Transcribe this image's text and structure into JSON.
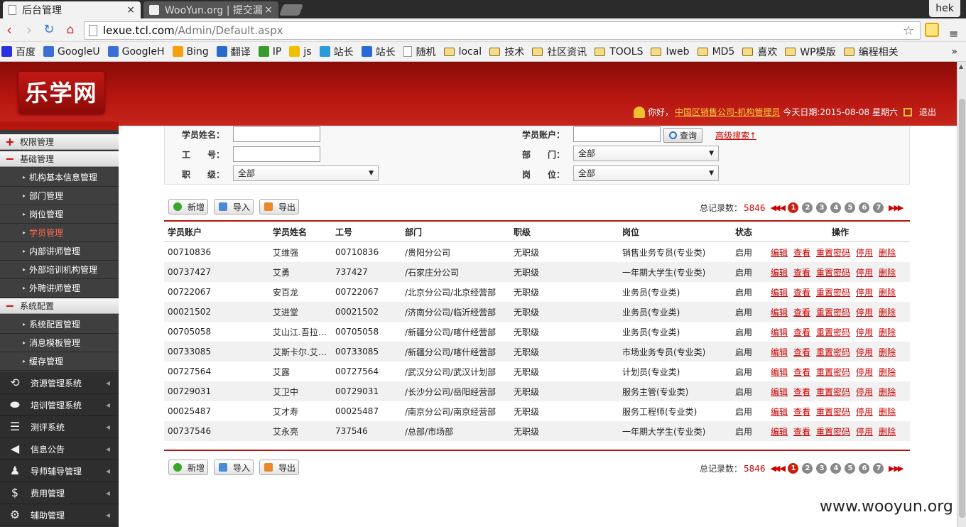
{
  "browser": {
    "tabs": [
      {
        "title": "后台管理",
        "active": true
      },
      {
        "title": "WooYun.org | 提交漏",
        "active": false
      }
    ],
    "user_badge": "hek",
    "url_host": "lexue.tcl.com",
    "url_path": "/Admin/Default.aspx",
    "bookmarks": [
      {
        "label": "百度",
        "icon": "baidu-icon",
        "color": "#2932e1"
      },
      {
        "label": "GoogleU",
        "icon": "google-icon",
        "color": "#3b6fd8"
      },
      {
        "label": "GoogleH",
        "icon": "google-icon",
        "color": "#3b6fd8"
      },
      {
        "label": "Bing",
        "icon": "bing-icon",
        "color": "#f2a10c"
      },
      {
        "label": "翻译",
        "icon": "translate-icon",
        "color": "#2a6ac9"
      },
      {
        "label": "IP",
        "icon": "ip-icon",
        "color": "#3a9a2a"
      },
      {
        "label": "js",
        "icon": "js-icon",
        "color": "#f0c000"
      },
      {
        "label": "站长",
        "icon": "chinaz-icon",
        "color": "#2a9ad8"
      },
      {
        "label": "站长",
        "icon": "chinaz-icon",
        "color": "#2a6ad8"
      },
      {
        "label": "随机",
        "icon": "doc-icon",
        "color": ""
      },
      {
        "label": "local",
        "icon": "folder-icon",
        "color": ""
      },
      {
        "label": "技术",
        "icon": "folder-icon",
        "color": ""
      },
      {
        "label": "社区资讯",
        "icon": "folder-icon",
        "color": ""
      },
      {
        "label": "TOOLS",
        "icon": "folder-icon",
        "color": ""
      },
      {
        "label": "Iweb",
        "icon": "folder-icon",
        "color": ""
      },
      {
        "label": "MD5",
        "icon": "folder-icon",
        "color": ""
      },
      {
        "label": "喜欢",
        "icon": "folder-icon",
        "color": ""
      },
      {
        "label": "WP模版",
        "icon": "folder-icon",
        "color": ""
      },
      {
        "label": "编程相关",
        "icon": "folder-icon",
        "color": ""
      }
    ],
    "bookmarks_more": "»"
  },
  "header": {
    "logo_text": "乐学网",
    "greeting": "你好，",
    "user_link": "中国区销售公司-机构管理员",
    "date_text": "今天日期:2015-08-08 星期六",
    "logout": "退出",
    "brand_color": "#b5150f"
  },
  "sidebar": {
    "groups": [
      {
        "label": "权限管理",
        "toggle": "+"
      },
      {
        "label": "基础管理",
        "toggle": "−"
      }
    ],
    "basic_items": [
      {
        "label": "机构基本信息管理",
        "active": false
      },
      {
        "label": "部门管理",
        "active": false
      },
      {
        "label": "岗位管理",
        "active": false
      },
      {
        "label": "学员管理",
        "active": true
      },
      {
        "label": "内部讲师管理",
        "active": false
      },
      {
        "label": "外部培训机构管理",
        "active": false
      },
      {
        "label": "外聘讲师管理",
        "active": false
      }
    ],
    "config_group": {
      "label": "系统配置",
      "toggle": "−"
    },
    "config_items": [
      {
        "label": "系统配置管理"
      },
      {
        "label": "消息模板管理"
      },
      {
        "label": "缓存管理"
      }
    ],
    "systems": [
      {
        "label": "资源管理系统",
        "icon": "resource-icon"
      },
      {
        "label": "培训管理系统",
        "icon": "training-icon"
      },
      {
        "label": "测评系统",
        "icon": "evaluation-icon"
      },
      {
        "label": "信息公告",
        "icon": "announcement-icon"
      },
      {
        "label": "导师辅导管理",
        "icon": "mentor-icon"
      },
      {
        "label": "费用管理",
        "icon": "cost-icon"
      },
      {
        "label": "辅助管理",
        "icon": "auxiliary-icon"
      }
    ]
  },
  "filter": {
    "name_label": "学员姓名：",
    "account_label": "学员账户：",
    "search_button": "查询",
    "advanced_search": "高级搜索",
    "advanced_arrow": "↑",
    "empno_label": "工　　号：",
    "dept_label": "部　　门：",
    "dept_value": "全部",
    "rank_label": "职　　级：",
    "rank_value": "全部",
    "position_label": "岗　　位：",
    "position_value": "全部"
  },
  "actions": {
    "add": "新增",
    "import": "导入",
    "export": "导出"
  },
  "pager": {
    "total_label": "总记录数：",
    "total": "5846",
    "pages": [
      "1",
      "2",
      "3",
      "4",
      "5",
      "6",
      "7"
    ],
    "current": "1"
  },
  "table": {
    "columns": [
      "学员账户",
      "学员姓名",
      "工号",
      "部门",
      "职级",
      "岗位",
      "状态",
      "操作"
    ],
    "row_ops": [
      "编辑",
      "查看",
      "重置密码",
      "停用",
      "删除"
    ],
    "rows": [
      [
        "00710836",
        "艾维强",
        "00710836",
        "/贵阳分公司",
        "无职级",
        "销售业务专员(专业类)",
        "启用"
      ],
      [
        "00737427",
        "艾勇",
        "737427",
        "/石家庄分公司",
        "无职级",
        "一年期大学生(专业类)",
        "启用"
      ],
      [
        "00722067",
        "安百龙",
        "00722067",
        "/北京分公司/北京经营部",
        "无职级",
        "业务员(专业类)",
        "启用"
      ],
      [
        "00021502",
        "艾进堂",
        "00021502",
        "/济南分公司/临沂经营部",
        "无职级",
        "业务员(专业类)",
        "启用"
      ],
      [
        "00705058",
        "艾山江.吾拉…",
        "00705058",
        "/新疆分公司/喀什经营部",
        "无职级",
        "业务员(专业类)",
        "启用"
      ],
      [
        "00733085",
        "艾斯卡尔.艾…",
        "00733085",
        "/新疆分公司/喀什经营部",
        "无职级",
        "市场业务专员(专业类)",
        "启用"
      ],
      [
        "00727564",
        "艾露",
        "00727564",
        "/武汉分公司/武汉计划部",
        "无职级",
        "计划员(专业类)",
        "启用"
      ],
      [
        "00729031",
        "艾卫中",
        "00729031",
        "/长沙分公司/岳阳经营部",
        "无职级",
        "服务主管(专业类)",
        "启用"
      ],
      [
        "00025487",
        "艾才寿",
        "00025487",
        "/南京分公司/南京经营部",
        "无职级",
        "服务工程师(专业类)",
        "启用"
      ],
      [
        "00737546",
        "艾永亮",
        "737546",
        "/总部/市场部",
        "无职级",
        "一年期大学生(专业类)",
        "启用"
      ]
    ]
  },
  "watermark": "www.wooyun.org"
}
